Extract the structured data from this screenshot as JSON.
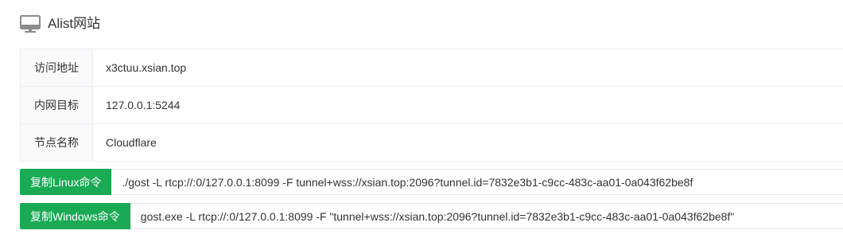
{
  "panel": {
    "title": "Alist网站",
    "icon": "monitor-icon"
  },
  "info_rows": [
    {
      "label": "访问地址",
      "value": "x3ctuu.xsian.top"
    },
    {
      "label": "内网目标",
      "value": "127.0.0.1:5244"
    },
    {
      "label": "节点名称",
      "value": "Cloudflare"
    }
  ],
  "commands": {
    "linux": {
      "button_label": "复制Linux命令",
      "command": "./gost -L rtcp://:0/127.0.0.1:8099 -F tunnel+wss://xsian.top:2096?tunnel.id=7832e3b1-c9cc-483c-aa01-0a043f62be8f"
    },
    "windows": {
      "button_label": "复制Windows命令",
      "command": "gost.exe -L rtcp://:0/127.0.0.1:8099 -F \"tunnel+wss://xsian.top:2096?tunnel.id=7832e3b1-c9cc-483c-aa01-0a043f62be8f\""
    }
  },
  "colors": {
    "button_green": "#1aaa55",
    "label_bg": "#fafafa",
    "border": "#ebeef5",
    "icon_gray": "#8c8c8c"
  }
}
